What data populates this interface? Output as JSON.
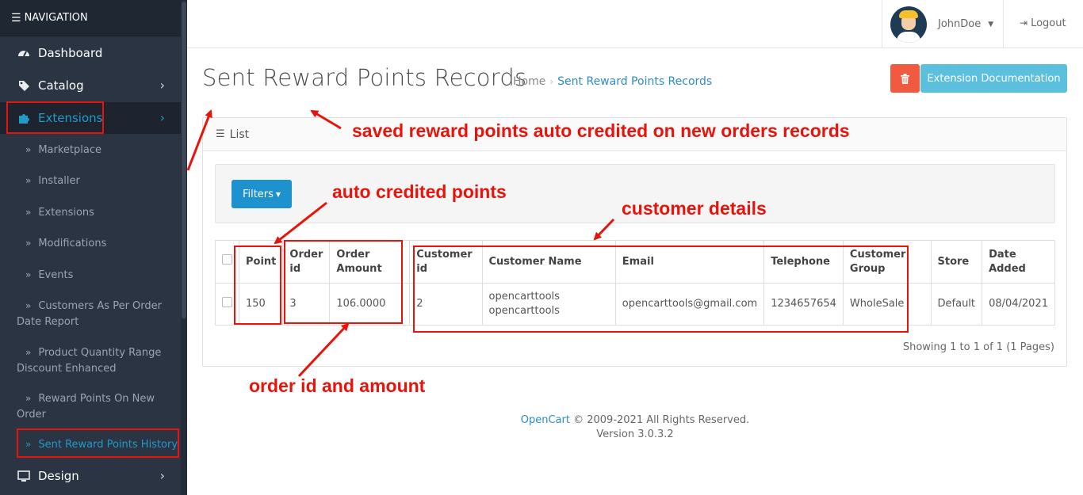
{
  "sidebar": {
    "header": "NAVIGATION",
    "menu": [
      {
        "label": "Dashboard",
        "icon": "dashboard-icon"
      },
      {
        "label": "Catalog",
        "icon": "tag-icon"
      },
      {
        "label": "Extensions",
        "icon": "puzzle-icon"
      },
      {
        "label": "Design",
        "icon": "monitor-icon"
      }
    ],
    "sub_items": [
      {
        "label": "Marketplace"
      },
      {
        "label": "Installer"
      },
      {
        "label": "Extensions"
      },
      {
        "label": "Modifications"
      },
      {
        "label": "Events"
      },
      {
        "label": "Customers As Per Order Date Report"
      },
      {
        "label": "Product Quantity Range Discount Enhanced"
      },
      {
        "label": "Reward Points On New Order"
      },
      {
        "label": "Sent Reward Points History"
      }
    ]
  },
  "header": {
    "user_name": "JohnDoe",
    "logout_label": "Logout"
  },
  "page": {
    "title": "Sent Reward Points Records",
    "breadcrumb_home": "Home",
    "breadcrumb_current": "Sent Reward Points Records",
    "doc_button": "Extension Documentation"
  },
  "panel": {
    "heading": "List",
    "filter_button": "Filters",
    "columns": [
      "Point",
      "Order id",
      "Order Amount",
      "Customer id",
      "Customer Name",
      "Email",
      "Telephone",
      "Customer Group",
      "Store",
      "Date Added"
    ],
    "rows": [
      {
        "point": "150",
        "order_id": "3",
        "order_amount": "106.0000",
        "customer_id": "2",
        "customer_name_1": "opencarttools",
        "customer_name_2": "opencarttools",
        "email": "opencarttools@gmail.com",
        "telephone": "1234657654",
        "customer_group": "WholeSale",
        "store": "Default",
        "date_added": "08/04/2021"
      }
    ],
    "showing": "Showing 1 to 1 of 1 (1 Pages)"
  },
  "footer": {
    "brand": "OpenCart",
    "copyright": " © 2009-2021 All Rights Reserved.",
    "version": "Version 3.0.3.2"
  },
  "annotations": {
    "saved": "saved reward points auto credited on new orders records",
    "auto_points": "auto credited points",
    "customer_details": "customer details",
    "order_id_amount": "order id and amount"
  },
  "colors": {
    "sidebar_bg": "#2a3442",
    "accent": "#229ac8",
    "annotation": "#e8140c",
    "delete_button": "#f05a40",
    "doc_button": "#5bc0de",
    "filter_button": "#1e91cf"
  }
}
